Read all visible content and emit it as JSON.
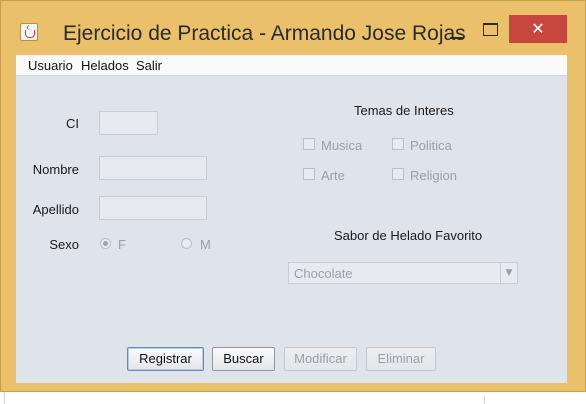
{
  "window": {
    "title": "Ejercicio de Practica - Armando Jose Rojas",
    "close_glyph": "✕",
    "accent_color": "#eac06a",
    "close_color": "#c7463e"
  },
  "menubar": {
    "items": [
      "Usuario",
      "Helados",
      "Salir"
    ]
  },
  "form": {
    "ci_label": "CI",
    "ci_value": "",
    "nombre_label": "Nombre",
    "nombre_value": "",
    "apellido_label": "Apellido",
    "apellido_value": "",
    "sexo_label": "Sexo",
    "sexo_options": [
      "F",
      "M"
    ],
    "sexo_selected": "F"
  },
  "interests": {
    "title": "Temas de Interes",
    "options": [
      "Musica",
      "Politica",
      "Arte",
      "Religion"
    ]
  },
  "flavor": {
    "title": "Sabor de Helado Favorito",
    "selected": "Chocolate"
  },
  "buttons": {
    "registrar": "Registrar",
    "buscar": "Buscar",
    "modificar": "Modificar",
    "eliminar": "Eliminar"
  }
}
